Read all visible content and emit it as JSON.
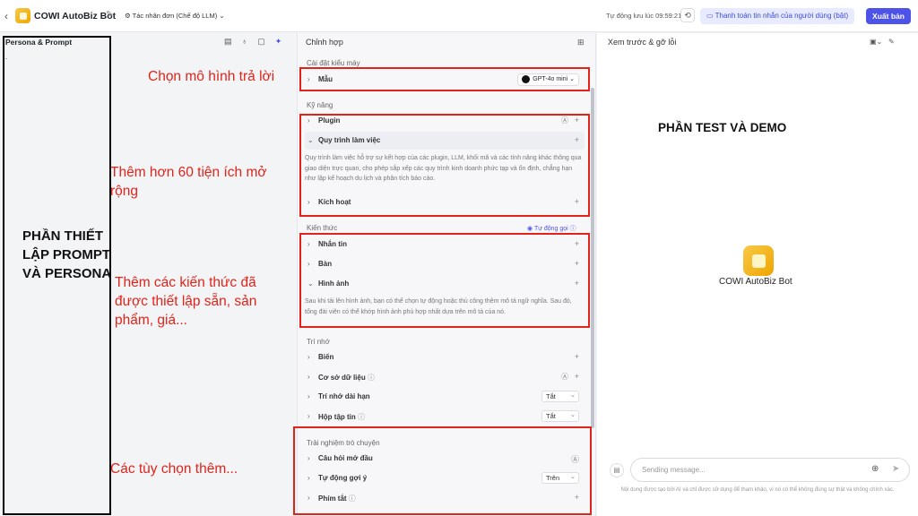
{
  "header": {
    "back_icon": "chevron-left-icon",
    "bot_name": "COWI AutoBiz Bot",
    "mode": "Tác nhân đơn (Chế độ LLM)",
    "autosave": "Tự động lưu lúc 09:59:21",
    "sync_button": "Thanh toán tin nhắn của người dùng (bật)",
    "publish_button": "Xuất bản"
  },
  "left": {
    "title": "Persona & Prompt",
    "placeholder_dot": ".",
    "overlay_label": "PHẦN THIẾT LẬP PROMPT VÀ PERSONA"
  },
  "annotations": {
    "model": "Chọn mô hình trả lời",
    "skills": "Thêm hơn 60 tiện ích mở rộng",
    "knowledge": "Thêm các kiến thức đã được thiết lập sẵn, sản phẩm, giá...",
    "more": "Các tùy chọn thêm..."
  },
  "middle": {
    "title": "Chỉnh hợp",
    "model_section": "Cài đặt kiểu máy",
    "model_row": "Mẫu",
    "model_value": "GPT-4o mini",
    "skills_section": "Kỹ năng",
    "plugin": "Plugin",
    "workflow": "Quy trình làm việc",
    "workflow_desc": "Quy trình làm việc hỗ trợ sự kết hợp của các plugin, LLM, khối mã và các tính năng khác thông qua giao diện trực quan, cho phép sắp xếp các quy trình kinh doanh phức tạp và ổn định, chẳng hạn như lập kế hoạch du lịch và phân tích báo cáo.",
    "trigger": "Kích hoạt",
    "knowledge_section": "Kiến thức",
    "auto_suggest": "Tự động gọi",
    "text": "Nhắn tin",
    "table": "Bàn",
    "image": "Hình ảnh",
    "image_desc": "Sau khi tải lên hình ảnh, bạn có thể chọn tự động hoặc thủ công thêm mô tả ngữ nghĩa. Sau đó, tổng đài viên có thể khớp hình ảnh phù hợp nhất dựa trên mô tả của nó.",
    "memory_section": "Trí nhớ",
    "variables": "Biến",
    "database": "Cơ sở dữ liệu",
    "long_memory": "Trí nhớ dài hạn",
    "long_memory_value": "Tắt",
    "filebox": "Hộp tập tin",
    "filebox_value": "Tắt",
    "chat_section": "Trải nghiệm trò chuyện",
    "opening": "Câu hỏi mở đầu",
    "auto_suggestion": "Tự động gợi ý",
    "auto_suggestion_value": "Trên",
    "shortcuts": "Phím tắt"
  },
  "right": {
    "title": "Xem trước & gỡ lỗi",
    "overlay_label": "PHẦN TEST VÀ DEMO",
    "bot_name": "COWI AutoBiz Bot",
    "input_placeholder": "Sending message...",
    "disclaimer": "Nội dung được tạo bởi AI và chỉ được sử dụng để tham khảo, vì nó có thể không đúng sự thật và không chính xác."
  }
}
